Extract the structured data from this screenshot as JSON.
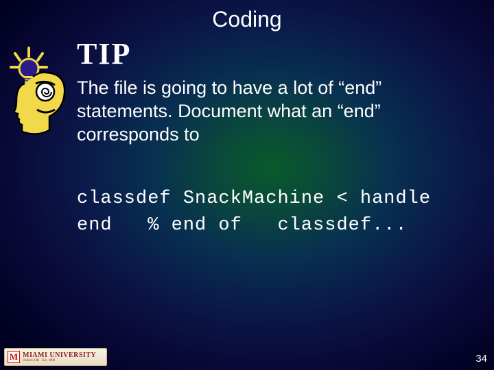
{
  "title": "Coding",
  "tip_label": "TIP",
  "body": "The file is going to have a lot of “end” statements. Document what an “end” corresponds to",
  "code_line1": "classdef SnackMachine < handle",
  "code_line2": "end   % end of   classdef...",
  "page_number": "34",
  "logo": {
    "letter": "M",
    "text": "MIAMI UNIVERSITY",
    "subtext": "Oxford, OH · Est. 1809"
  },
  "icons": {
    "idea": "idea-head-icon"
  }
}
